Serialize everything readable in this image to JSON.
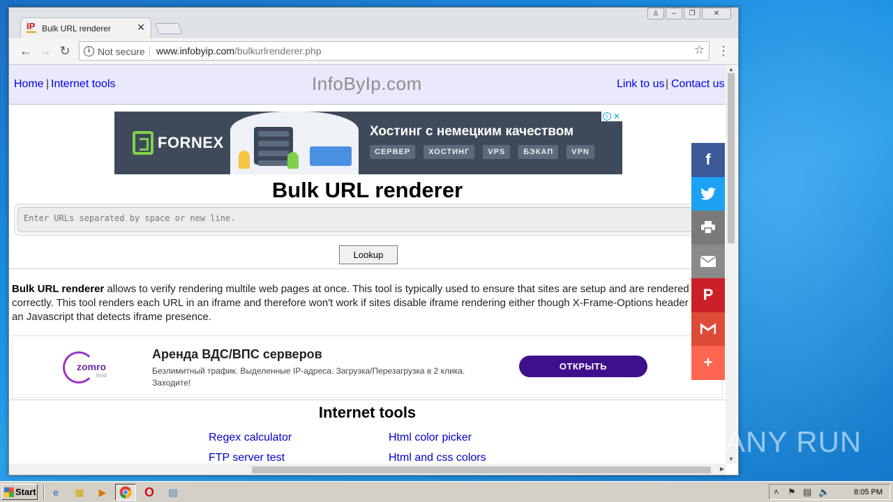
{
  "browser": {
    "tab_title": "Bulk URL renderer",
    "favicon_text": "IP",
    "security_label": "Not secure",
    "url_domain": "www.infobyip.com",
    "url_path": "/bulkurlrenderer.php"
  },
  "header": {
    "nav_left": [
      "Home",
      "Internet tools"
    ],
    "logo": "InfoByIp.com",
    "nav_right": [
      "Link to us",
      "Contact us"
    ],
    "separator": "|"
  },
  "ad_top": {
    "brand": "FORNEX",
    "headline": "Хостинг с немецким качеством",
    "tags": [
      "СЕРВЕР",
      "ХОСТИНГ",
      "VPS",
      "БЭКАП",
      "VPN"
    ]
  },
  "main": {
    "title": "Bulk URL renderer",
    "input_placeholder": "Enter URLs separated by space or new line.",
    "lookup_label": "Lookup",
    "desc_bold": "Bulk URL renderer",
    "desc_rest": " allows to verify rendering multile web pages at once. This tool is typically used to ensure that sites are setup and are rendered correctly. This tool renders each URL in an iframe and therefore won't work if sites disable iframe rendering either though X-Frame-Options header or via an Javascript that detects iframe presence."
  },
  "ad_second": {
    "brand": "zomro",
    "brand_sub": "host",
    "title": "Аренда ВДС/ВПС серверов",
    "text": "Безлимитный трафик. Выделенные IP-адреса. Загрузка/Перезагрузка в 2 клика. Заходите!",
    "button": "ОТКРЫТЬ"
  },
  "tools": {
    "title": "Internet tools",
    "links": [
      "Regex calculator",
      "Html color picker",
      "FTP server test",
      "Html and css colors"
    ]
  },
  "share_bar": [
    {
      "name": "facebook",
      "color": "#3b5998"
    },
    {
      "name": "twitter",
      "color": "#1da1f2"
    },
    {
      "name": "print",
      "color": "#7a7a7a"
    },
    {
      "name": "email",
      "color": "#8a8a8a"
    },
    {
      "name": "pinterest",
      "color": "#cb2027"
    },
    {
      "name": "gmail",
      "color": "#dd4b39"
    },
    {
      "name": "more",
      "color": "#ff6550"
    }
  ],
  "watermark": "ANY RUN",
  "taskbar": {
    "start_label": "Start",
    "clock": "8:05 PM"
  }
}
